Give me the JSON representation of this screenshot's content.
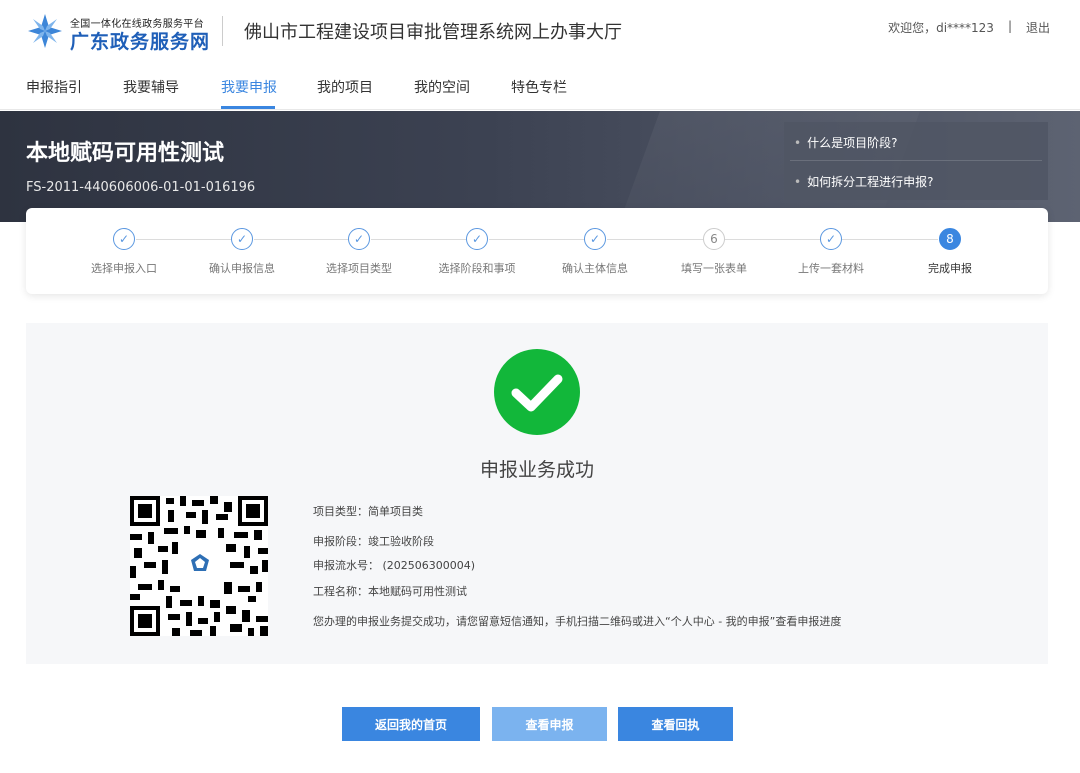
{
  "header": {
    "logo_small": "全国一体化在线政务服务平台",
    "logo_big": "广东政务服务网",
    "system_title": "佛山市工程建设项目审批管理系统网上办事大厅",
    "welcome": "欢迎您，",
    "username": "di****123",
    "separator": "|",
    "logout": "退出"
  },
  "nav": {
    "items": [
      {
        "label": "申报指引"
      },
      {
        "label": "我要辅导"
      },
      {
        "label": "我要申报",
        "active": true
      },
      {
        "label": "我的项目"
      },
      {
        "label": "我的空间"
      },
      {
        "label": "特色专栏"
      }
    ]
  },
  "banner": {
    "title": "本地赋码可用性测试",
    "code": "FS-2011-440606006-01-01-016196",
    "faq": [
      "什么是项目阶段?",
      "如何拆分工程进行申报?"
    ]
  },
  "steps": {
    "items": [
      {
        "label": "选择申报入口",
        "status": "done"
      },
      {
        "label": "确认申报信息",
        "status": "done"
      },
      {
        "label": "选择项目类型",
        "status": "done"
      },
      {
        "label": "选择阶段和事项",
        "status": "done"
      },
      {
        "label": "确认主体信息",
        "status": "done"
      },
      {
        "label": "填写一张表单",
        "status": "todo",
        "number": "6"
      },
      {
        "label": "上传一套材料",
        "status": "done"
      },
      {
        "label": "完成申报",
        "status": "current",
        "number": "8"
      }
    ]
  },
  "result": {
    "title": "申报业务成功",
    "project_type": "项目类型：简单项目类",
    "stage": "申报阶段：竣工验收阶段",
    "serial": "申报流水号：  (202506300004)",
    "project_name": "工程名称：本地赋码可用性测试",
    "notice": "您办理的申报业务提交成功，请您留意短信通知，手机扫描二维码或进入“个人中心 - 我的申报”查看申报进度"
  },
  "buttons": {
    "home": "返回我的首页",
    "view_application": "查看申报",
    "view_receipt": "查看回执"
  },
  "colors": {
    "primary": "#3a86e0",
    "success": "#12b73a",
    "banner": "#3c4252"
  }
}
